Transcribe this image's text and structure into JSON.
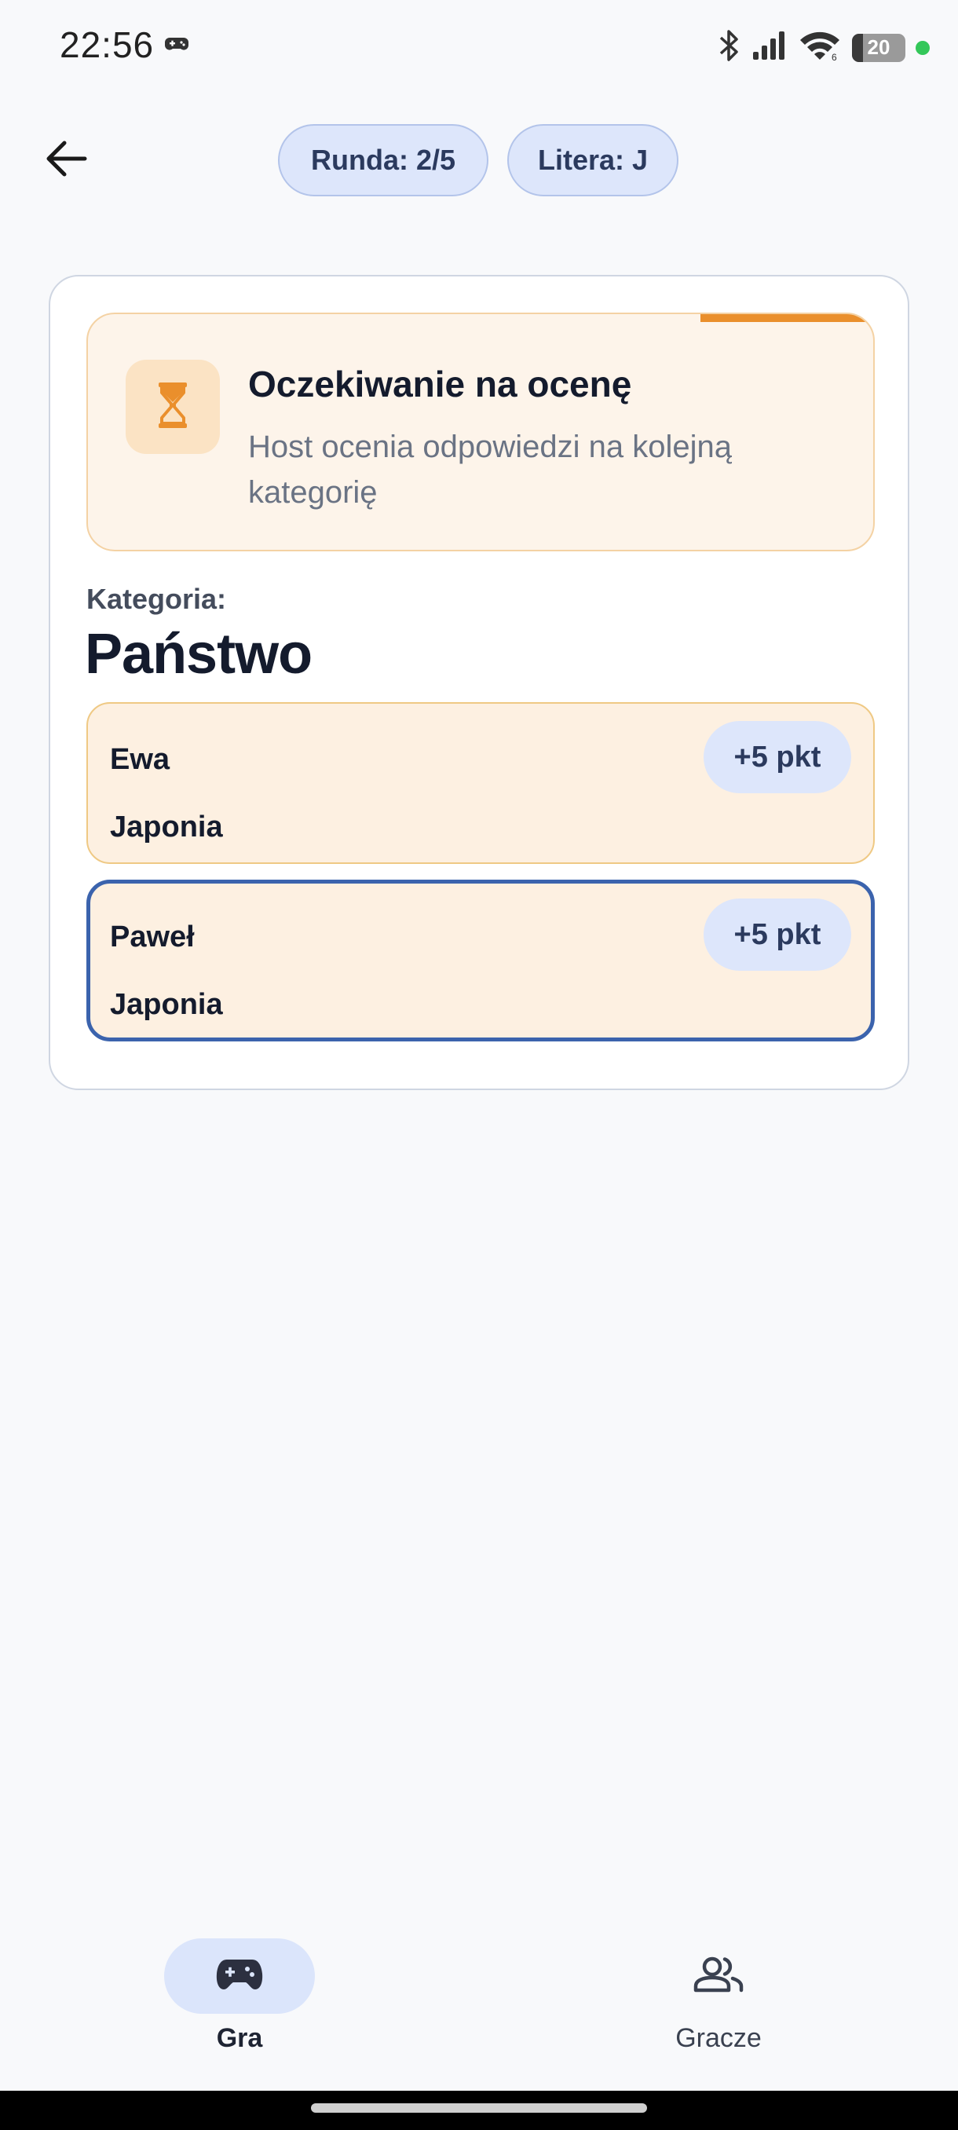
{
  "status_bar": {
    "time": "22:56",
    "battery_level": "20",
    "battery_fraction": 0.2,
    "icons": [
      "game-controller-icon",
      "bluetooth-icon",
      "signal-icon",
      "wifi-icon",
      "battery-icon",
      "privacy-dot-icon"
    ]
  },
  "header": {
    "back_icon": "arrow-left-icon",
    "round_label": "Runda: 2/5",
    "letter_label": "Litera: J"
  },
  "waiting": {
    "icon": "hourglass-icon",
    "title": "Oczekiwanie na ocenę",
    "description": "Host ocenia odpowiedzi na kolejną kategorię",
    "progress_remaining_fraction": 0.22
  },
  "category": {
    "label": "Kategoria:",
    "name": "Państwo"
  },
  "answers": [
    {
      "player": "Ewa",
      "answer": "Japonia",
      "points": "+5 pkt"
    },
    {
      "player": "Paweł",
      "answer": "Japonia",
      "points": "+5 pkt",
      "selected": true
    }
  ],
  "bottom_nav": {
    "items": [
      {
        "label": "Gra",
        "icon": "gamepad-icon",
        "active": true
      },
      {
        "label": "Gracze",
        "icon": "people-icon",
        "active": false
      }
    ]
  },
  "colors": {
    "accent_orange": "#ea8f2c",
    "selected_border": "#3b63ad",
    "chip_bg": "#dde6fb"
  }
}
